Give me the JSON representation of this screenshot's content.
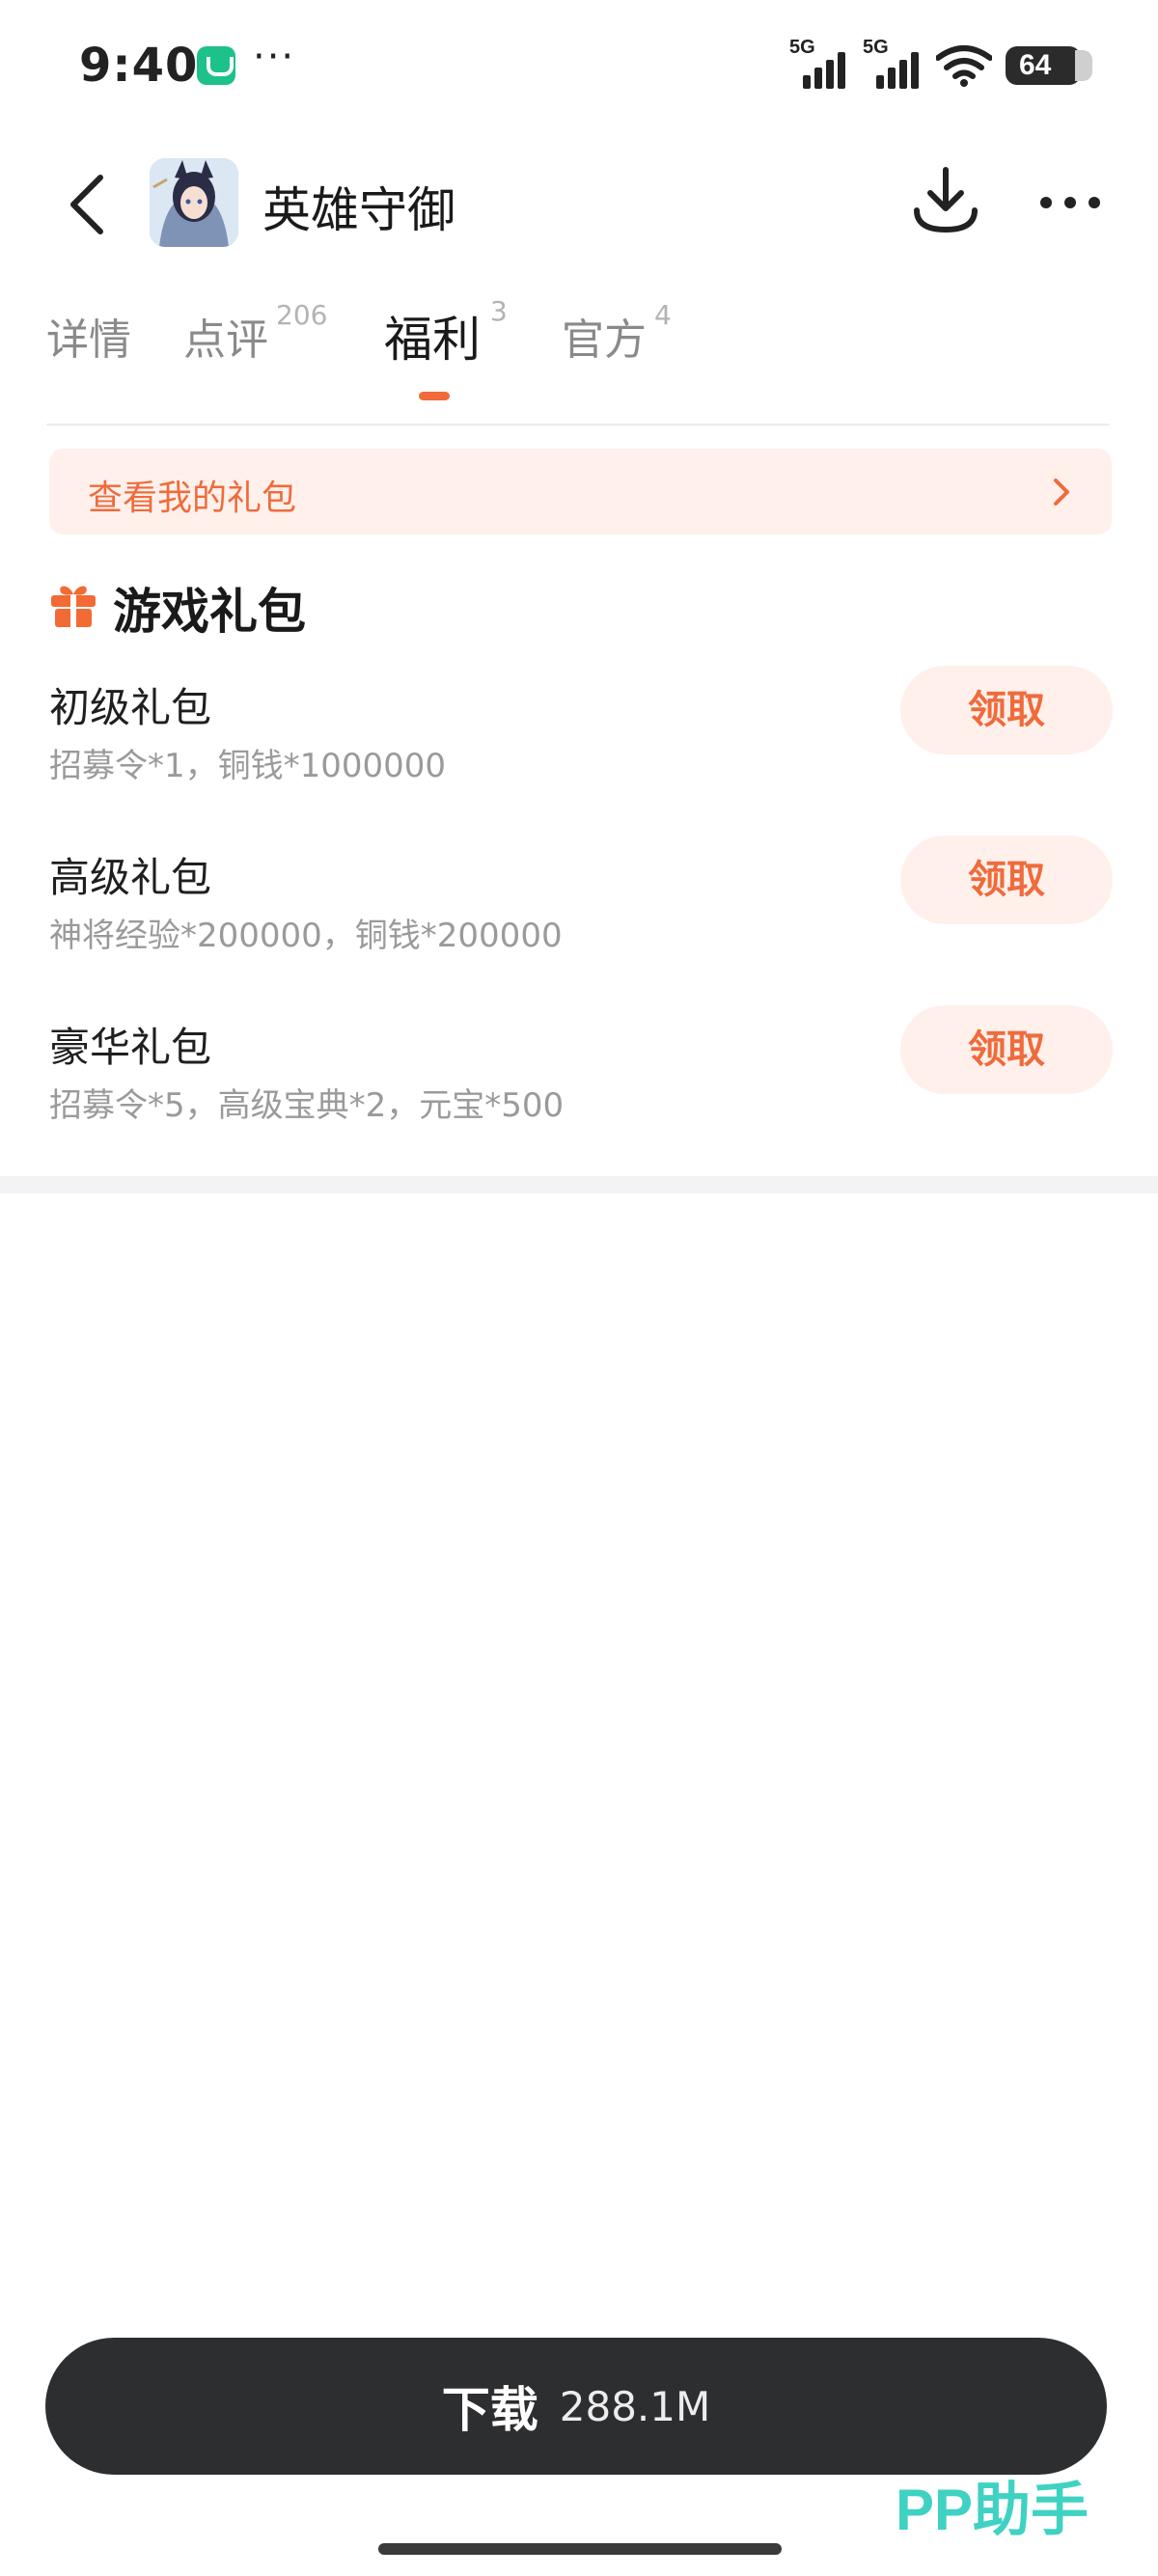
{
  "status_bar": {
    "time": "9:40",
    "more_dots": "···",
    "signal_1": "5G",
    "signal_2": "5G",
    "battery": "64"
  },
  "header": {
    "title": "英雄守御",
    "back_icon": "chevron-left-icon",
    "download_icon": "download-icon",
    "more_icon": "more-dots-icon"
  },
  "tabs": [
    {
      "label": "详情",
      "count": ""
    },
    {
      "label": "点评",
      "count": "206"
    },
    {
      "label": "福利",
      "count": "3"
    },
    {
      "label": "官方",
      "count": "4"
    }
  ],
  "active_tab": "福利",
  "my_gifts": {
    "label": "查看我的礼包"
  },
  "section": {
    "title": "游戏礼包",
    "icon": "gift-icon",
    "packs": [
      {
        "name": "初级礼包",
        "desc": "招募令*1，铜钱*1000000",
        "button": "领取"
      },
      {
        "name": "高级礼包",
        "desc": "神将经验*200000，铜钱*200000",
        "button": "领取"
      },
      {
        "name": "豪华礼包",
        "desc": "招募令*5，高级宝典*2，元宝*500",
        "button": "领取"
      }
    ]
  },
  "download_bar": {
    "label": "下载",
    "size": "288.1M"
  },
  "watermark": "PP助手",
  "colors": {
    "accent": "#ef6b3c",
    "accent_bg": "#fff0eb",
    "download_bg": "#2d2e30",
    "watermark": "#3fd2c2"
  }
}
